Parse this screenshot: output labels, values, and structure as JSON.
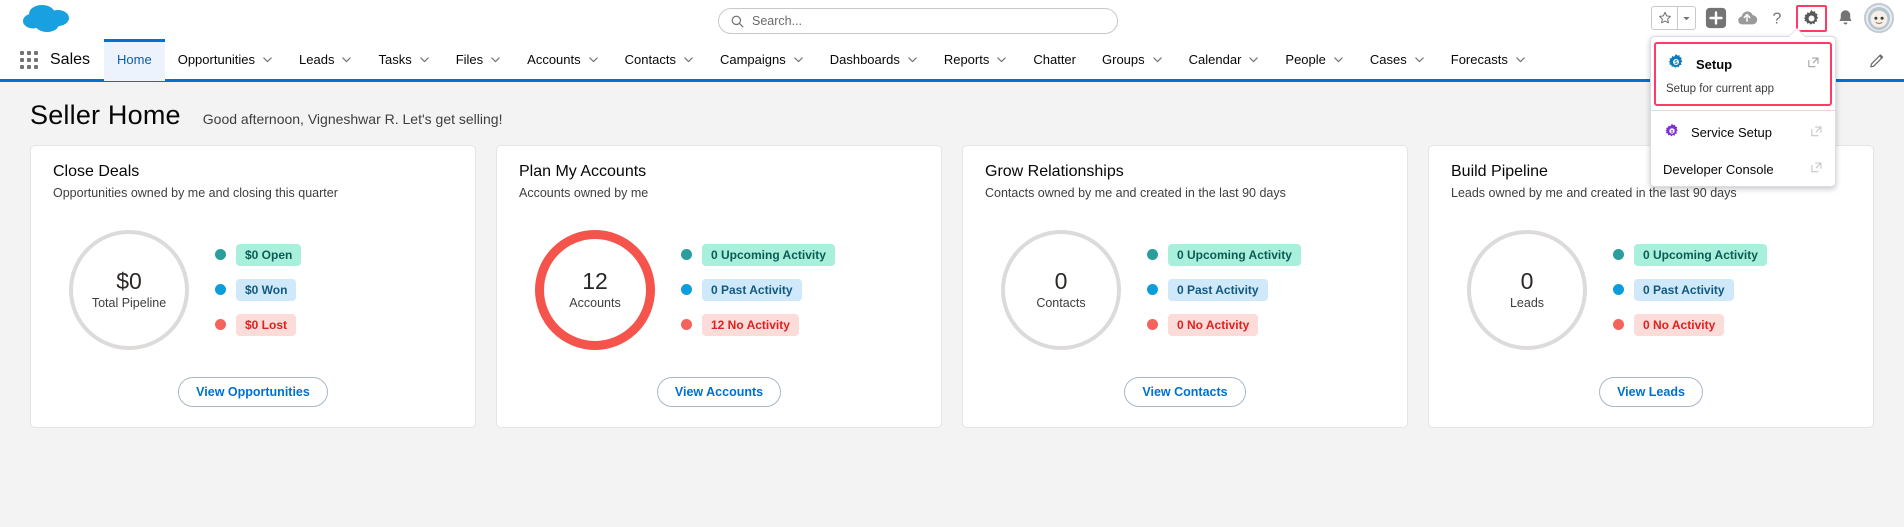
{
  "brand": {
    "cloud_color": "#18a0e0",
    "accent_blue": "#0070d2",
    "highlight_pink": "#ff3b66"
  },
  "topbar": {
    "logo_name": "salesforce-cloud-logo",
    "search": {
      "placeholder": "Search...",
      "value": "",
      "icon": "search-icon"
    },
    "icons": [
      {
        "name": "favorites-star-icon",
        "label": "Favorites"
      },
      {
        "name": "favorites-dropdown-caret-icon",
        "label": "Favorites list"
      },
      {
        "name": "add-icon",
        "label": "Add"
      },
      {
        "name": "cloud-setup-icon",
        "label": "Setup Assistant"
      },
      {
        "name": "help-icon",
        "label": "Help"
      },
      {
        "name": "gear-icon",
        "label": "Setup",
        "highlighted": true
      },
      {
        "name": "notifications-bell-icon",
        "label": "Notifications"
      },
      {
        "name": "avatar",
        "label": "User profile"
      }
    ]
  },
  "nav": {
    "app_launcher": "app-launcher-waffle-icon",
    "app_name": "Sales",
    "edit_icon": "pencil-edit-icon",
    "items": [
      {
        "label": "Home",
        "has_menu": false,
        "active": true
      },
      {
        "label": "Opportunities",
        "has_menu": true,
        "active": false
      },
      {
        "label": "Leads",
        "has_menu": true,
        "active": false
      },
      {
        "label": "Tasks",
        "has_menu": true,
        "active": false
      },
      {
        "label": "Files",
        "has_menu": true,
        "active": false
      },
      {
        "label": "Accounts",
        "has_menu": true,
        "active": false
      },
      {
        "label": "Contacts",
        "has_menu": true,
        "active": false
      },
      {
        "label": "Campaigns",
        "has_menu": true,
        "active": false
      },
      {
        "label": "Dashboards",
        "has_menu": true,
        "active": false
      },
      {
        "label": "Reports",
        "has_menu": true,
        "active": false
      },
      {
        "label": "Chatter",
        "has_menu": false,
        "active": false
      },
      {
        "label": "Groups",
        "has_menu": true,
        "active": false
      },
      {
        "label": "Calendar",
        "has_menu": true,
        "active": false
      },
      {
        "label": "People",
        "has_menu": true,
        "active": false
      },
      {
        "label": "Cases",
        "has_menu": true,
        "active": false
      },
      {
        "label": "Forecasts",
        "has_menu": true,
        "active": false
      }
    ]
  },
  "page": {
    "title": "Seller Home",
    "greeting": "Good afternoon, Vigneshwar R. Let's get selling!"
  },
  "cards": [
    {
      "title": "Close Deals",
      "subtitle": "Opportunities owned by me and closing this quarter",
      "donut": {
        "value": "$0",
        "label": "Total Pipeline",
        "ring_color": "#dddbda",
        "filled": false
      },
      "legend": [
        {
          "label": "$0 Open",
          "dot": "#2a9d9d",
          "bg": "#a8f0dc",
          "fg": "#0b5c55"
        },
        {
          "label": "$0 Won",
          "dot": "#0d9dda",
          "bg": "#cfe9fb",
          "fg": "#13597e"
        },
        {
          "label": "$0 Lost",
          "dot": "#f4645c",
          "bg": "#fcdcd8",
          "fg": "#e02020"
        }
      ],
      "button": "View Opportunities"
    },
    {
      "title": "Plan My Accounts",
      "subtitle": "Accounts owned by me",
      "donut": {
        "value": "12",
        "label": "Accounts",
        "ring_color": "#f4544c",
        "filled": true
      },
      "legend": [
        {
          "label": "0 Upcoming Activity",
          "dot": "#2a9d9d",
          "bg": "#a8f0dc",
          "fg": "#0b5c55"
        },
        {
          "label": "0 Past Activity",
          "dot": "#0d9dda",
          "bg": "#cfe9fb",
          "fg": "#13597e"
        },
        {
          "label": "12 No Activity",
          "dot": "#f4645c",
          "bg": "#fcdcd8",
          "fg": "#e02020"
        }
      ],
      "button": "View Accounts"
    },
    {
      "title": "Grow Relationships",
      "subtitle": "Contacts owned by me and created in the last 90 days",
      "donut": {
        "value": "0",
        "label": "Contacts",
        "ring_color": "#dddbda",
        "filled": false
      },
      "legend": [
        {
          "label": "0 Upcoming Activity",
          "dot": "#2a9d9d",
          "bg": "#a8f0dc",
          "fg": "#0b5c55"
        },
        {
          "label": "0 Past Activity",
          "dot": "#0d9dda",
          "bg": "#cfe9fb",
          "fg": "#13597e"
        },
        {
          "label": "0 No Activity",
          "dot": "#f4645c",
          "bg": "#fcdcd8",
          "fg": "#e02020"
        }
      ],
      "button": "View Contacts"
    },
    {
      "title": "Build Pipeline",
      "subtitle": "Leads owned by me and created in the last 90 days",
      "donut": {
        "value": "0",
        "label": "Leads",
        "ring_color": "#dddbda",
        "filled": false
      },
      "legend": [
        {
          "label": "0 Upcoming Activity",
          "dot": "#2a9d9d",
          "bg": "#a8f0dc",
          "fg": "#0b5c55"
        },
        {
          "label": "0 Past Activity",
          "dot": "#0d9dda",
          "bg": "#cfe9fb",
          "fg": "#13597e"
        },
        {
          "label": "0 No Activity",
          "dot": "#f4645c",
          "bg": "#fcdcd8",
          "fg": "#e02020"
        }
      ],
      "button": "View Leads"
    }
  ],
  "setup_menu": {
    "primary": {
      "label": "Setup",
      "sublabel": "Setup for current app",
      "icon": "gear-icon-blue",
      "external_icon": "external-link-icon",
      "highlighted": true
    },
    "items": [
      {
        "label": "Service Setup",
        "icon": "gear-icon-purple",
        "external_icon": "external-link-icon"
      },
      {
        "label": "Developer Console",
        "icon": null,
        "external_icon": "external-link-icon"
      }
    ]
  }
}
